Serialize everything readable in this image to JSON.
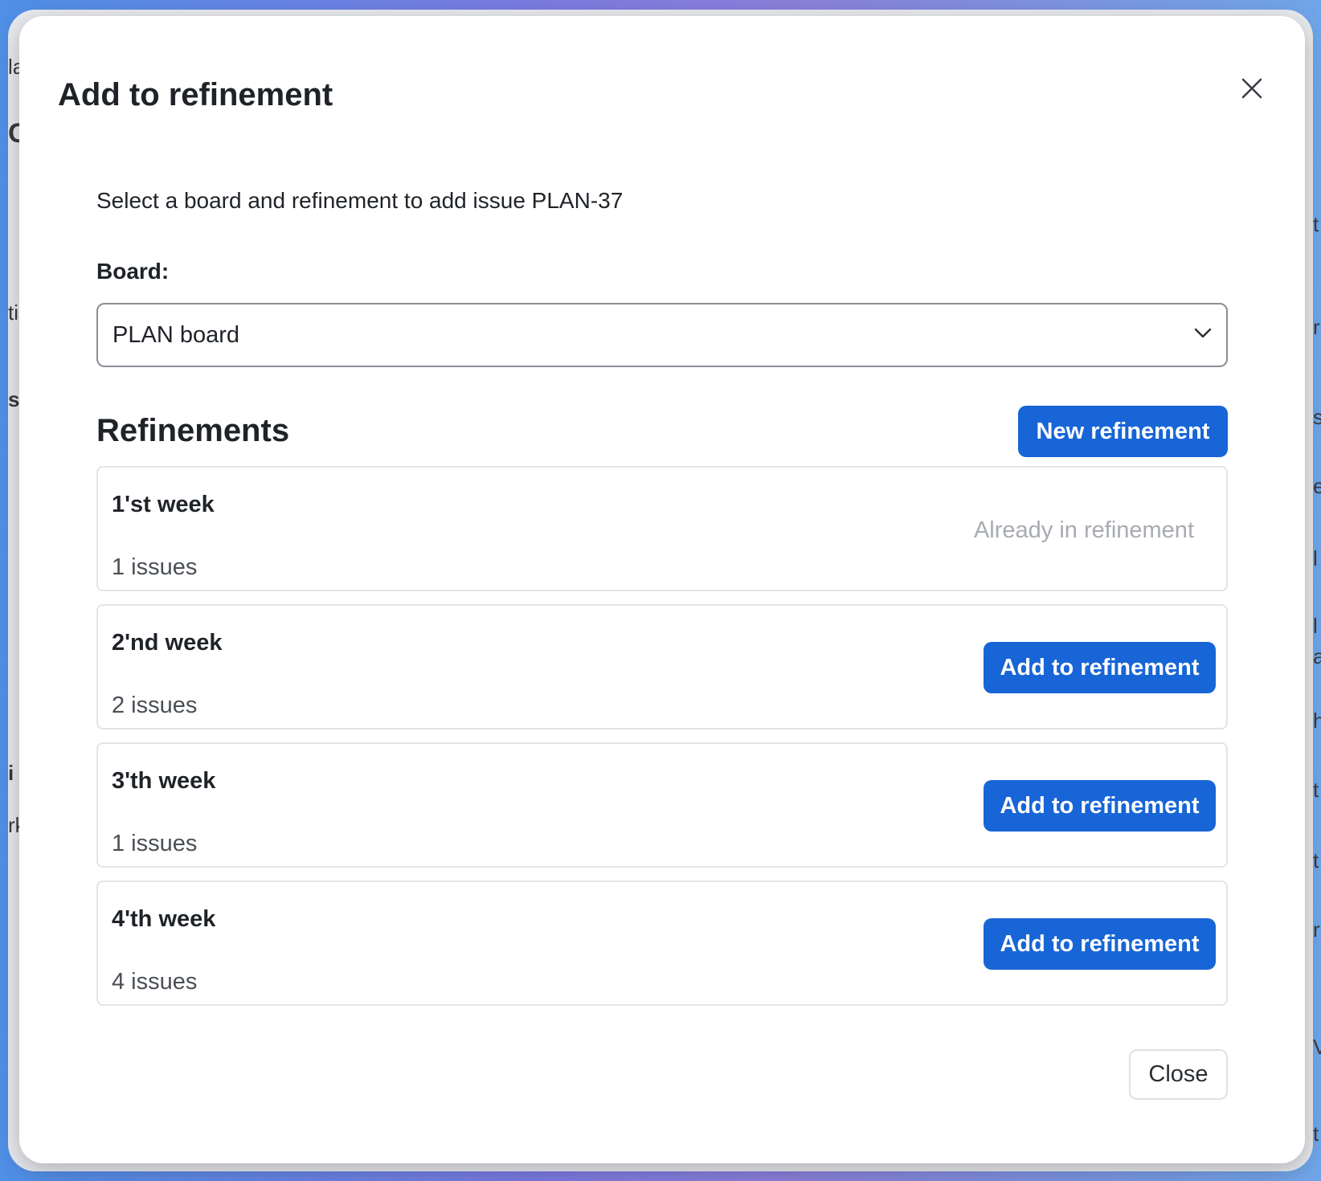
{
  "background_fragments": [
    "la",
    "C",
    "ti",
    "s",
    "i",
    "rk",
    "t",
    "r",
    "s",
    "er",
    "l",
    "l",
    "a",
    "ha",
    "t",
    "t",
    "r",
    "V",
    "t"
  ],
  "dialog": {
    "title": "Add to refinement",
    "close_icon": "close-icon",
    "intro_text": "Select a board and refinement to add issue PLAN-37",
    "board_label": "Board:",
    "board_select": {
      "value": "PLAN board",
      "icon": "chevron-down-icon"
    },
    "refinements_heading": "Refinements",
    "new_refinement_label": "New refinement",
    "refinements": [
      {
        "name": "1'st week",
        "count": "1 issues",
        "status": "Already in refinement"
      },
      {
        "name": "2'nd week",
        "count": "2 issues",
        "action": "Add to refinement"
      },
      {
        "name": "3'th week",
        "count": "1 issues",
        "action": "Add to refinement"
      },
      {
        "name": "4'th week",
        "count": "4 issues",
        "action": "Add to refinement"
      }
    ],
    "close_label": "Close"
  },
  "colors": {
    "primary": "#1765d6",
    "text": "#1f2328",
    "muted": "#a7abb1",
    "border": "#e2e4e8"
  }
}
